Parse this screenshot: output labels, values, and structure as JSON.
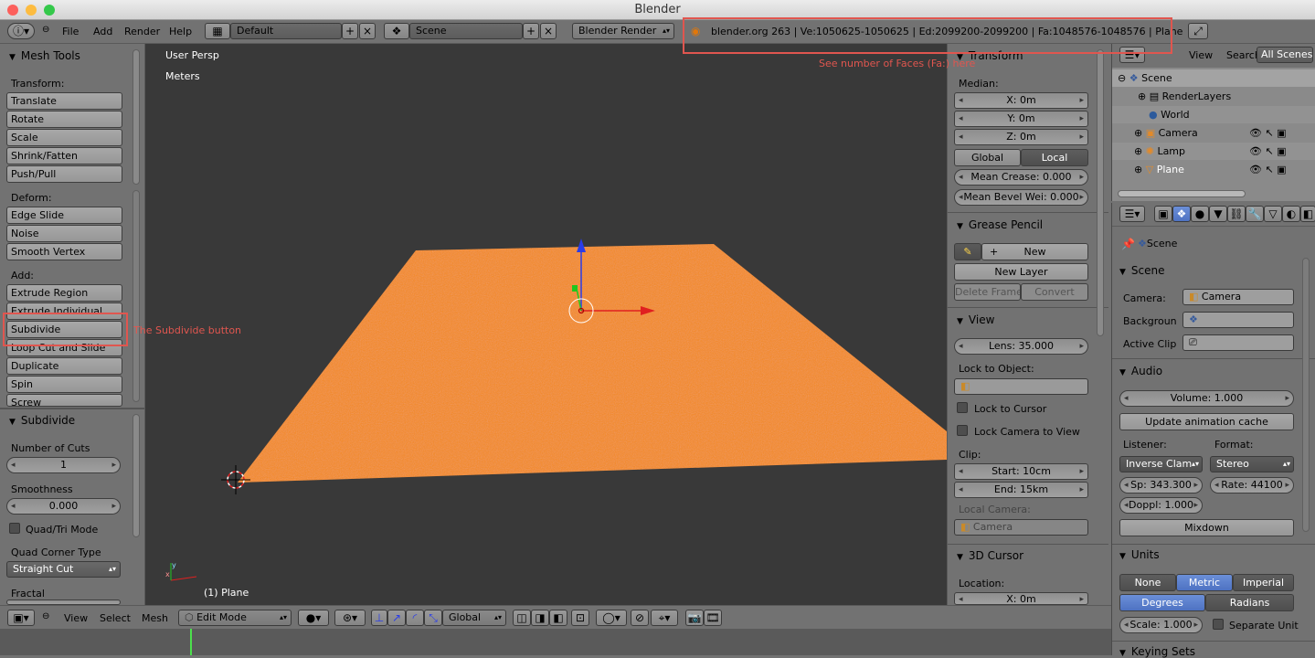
{
  "window": {
    "title": "Blender"
  },
  "info": {
    "menus": [
      "File",
      "Add",
      "Render",
      "Help"
    ],
    "screen_layout": "Default",
    "scene": "Scene",
    "engine": "Blender Render",
    "stats": "blender.org 263 | Ve:1050625-1050625 | Ed:2099200-2099200 | Fa:1048576-1048576 | Plane"
  },
  "annotations": {
    "faces_hint": "See number of Faces (Fa:) here",
    "subdivide_hint": "The Subdivide button"
  },
  "toolshelf": {
    "title": "Mesh Tools",
    "transform_label": "Transform:",
    "transform": [
      "Translate",
      "Rotate",
      "Scale",
      "Shrink/Fatten",
      "Push/Pull"
    ],
    "deform_label": "Deform:",
    "deform": [
      "Edge Slide",
      "Noise",
      "Smooth Vertex"
    ],
    "add_label": "Add:",
    "add": [
      "Extrude Region",
      "Extrude Individual",
      "Subdivide",
      "Loop Cut and Slide",
      "Duplicate",
      "Spin",
      "Screw"
    ]
  },
  "operator": {
    "title": "Subdivide",
    "cuts_label": "Number of Cuts",
    "cuts": "1",
    "smooth_label": "Smoothness",
    "smooth": "0.000",
    "quadtri": "Quad/Tri Mode",
    "corner_label": "Quad Corner Type",
    "corner": "Straight Cut",
    "fractal_label": "Fractal"
  },
  "viewport": {
    "view_name": "User Persp",
    "units": "Meters",
    "object": "(1) Plane",
    "colors": {
      "bg": "#393939",
      "plane": "#f58a1f"
    }
  },
  "properties": {
    "transform": {
      "title": "Transform",
      "median": "Median:",
      "x": "X: 0m",
      "y": "Y: 0m",
      "z": "Z: 0m",
      "global": "Global",
      "local": "Local",
      "crease": "Mean Crease: 0.000",
      "bevel": "Mean Bevel Wei: 0.000"
    },
    "grease": {
      "title": "Grease Pencil",
      "new": "New",
      "new_layer": "New Layer",
      "delete_frame": "Delete Frame",
      "convert": "Convert"
    },
    "view": {
      "title": "View",
      "lens": "Lens: 35.000",
      "lock_obj": "Lock to Object:",
      "lock_cursor": "Lock to Cursor",
      "lock_camera": "Lock Camera to View",
      "clip": "Clip:",
      "start": "Start: 10cm",
      "end": "End: 15km",
      "local_cam": "Local Camera:",
      "camera": "Camera"
    },
    "cursor": {
      "title": "3D Cursor",
      "location": "Location:",
      "x": "X: 0m"
    }
  },
  "outliner": {
    "view": "View",
    "search": "Search",
    "all_scenes": "All Scenes",
    "items": [
      "Scene",
      "RenderLayers",
      "World",
      "Camera",
      "Lamp",
      "Plane"
    ]
  },
  "scene_props": {
    "breadcrumb": "Scene",
    "scene_title": "Scene",
    "camera_label": "Camera:",
    "camera": "Camera",
    "background_label": "Backgroun",
    "clip_label": "Active Clip",
    "audio_title": "Audio",
    "volume": "Volume: 1.000",
    "update_cache": "Update animation cache",
    "listener_label": "Listener:",
    "format_label": "Format:",
    "listener": "Inverse Clam",
    "format": "Stereo",
    "speed": "Sp: 343.300",
    "rate": "Rate: 44100",
    "doppler": "Doppl: 1.000",
    "mixdown": "Mixdown",
    "units_title": "Units",
    "none": "None",
    "metric": "Metric",
    "imperial": "Imperial",
    "degrees": "Degrees",
    "radians": "Radians",
    "scale": "Scale: 1.000",
    "separate": "Separate Unit",
    "keying": "Keying Sets"
  },
  "footer": {
    "menus": [
      "View",
      "Select",
      "Mesh"
    ],
    "mode": "Edit Mode",
    "orientation": "Global"
  }
}
